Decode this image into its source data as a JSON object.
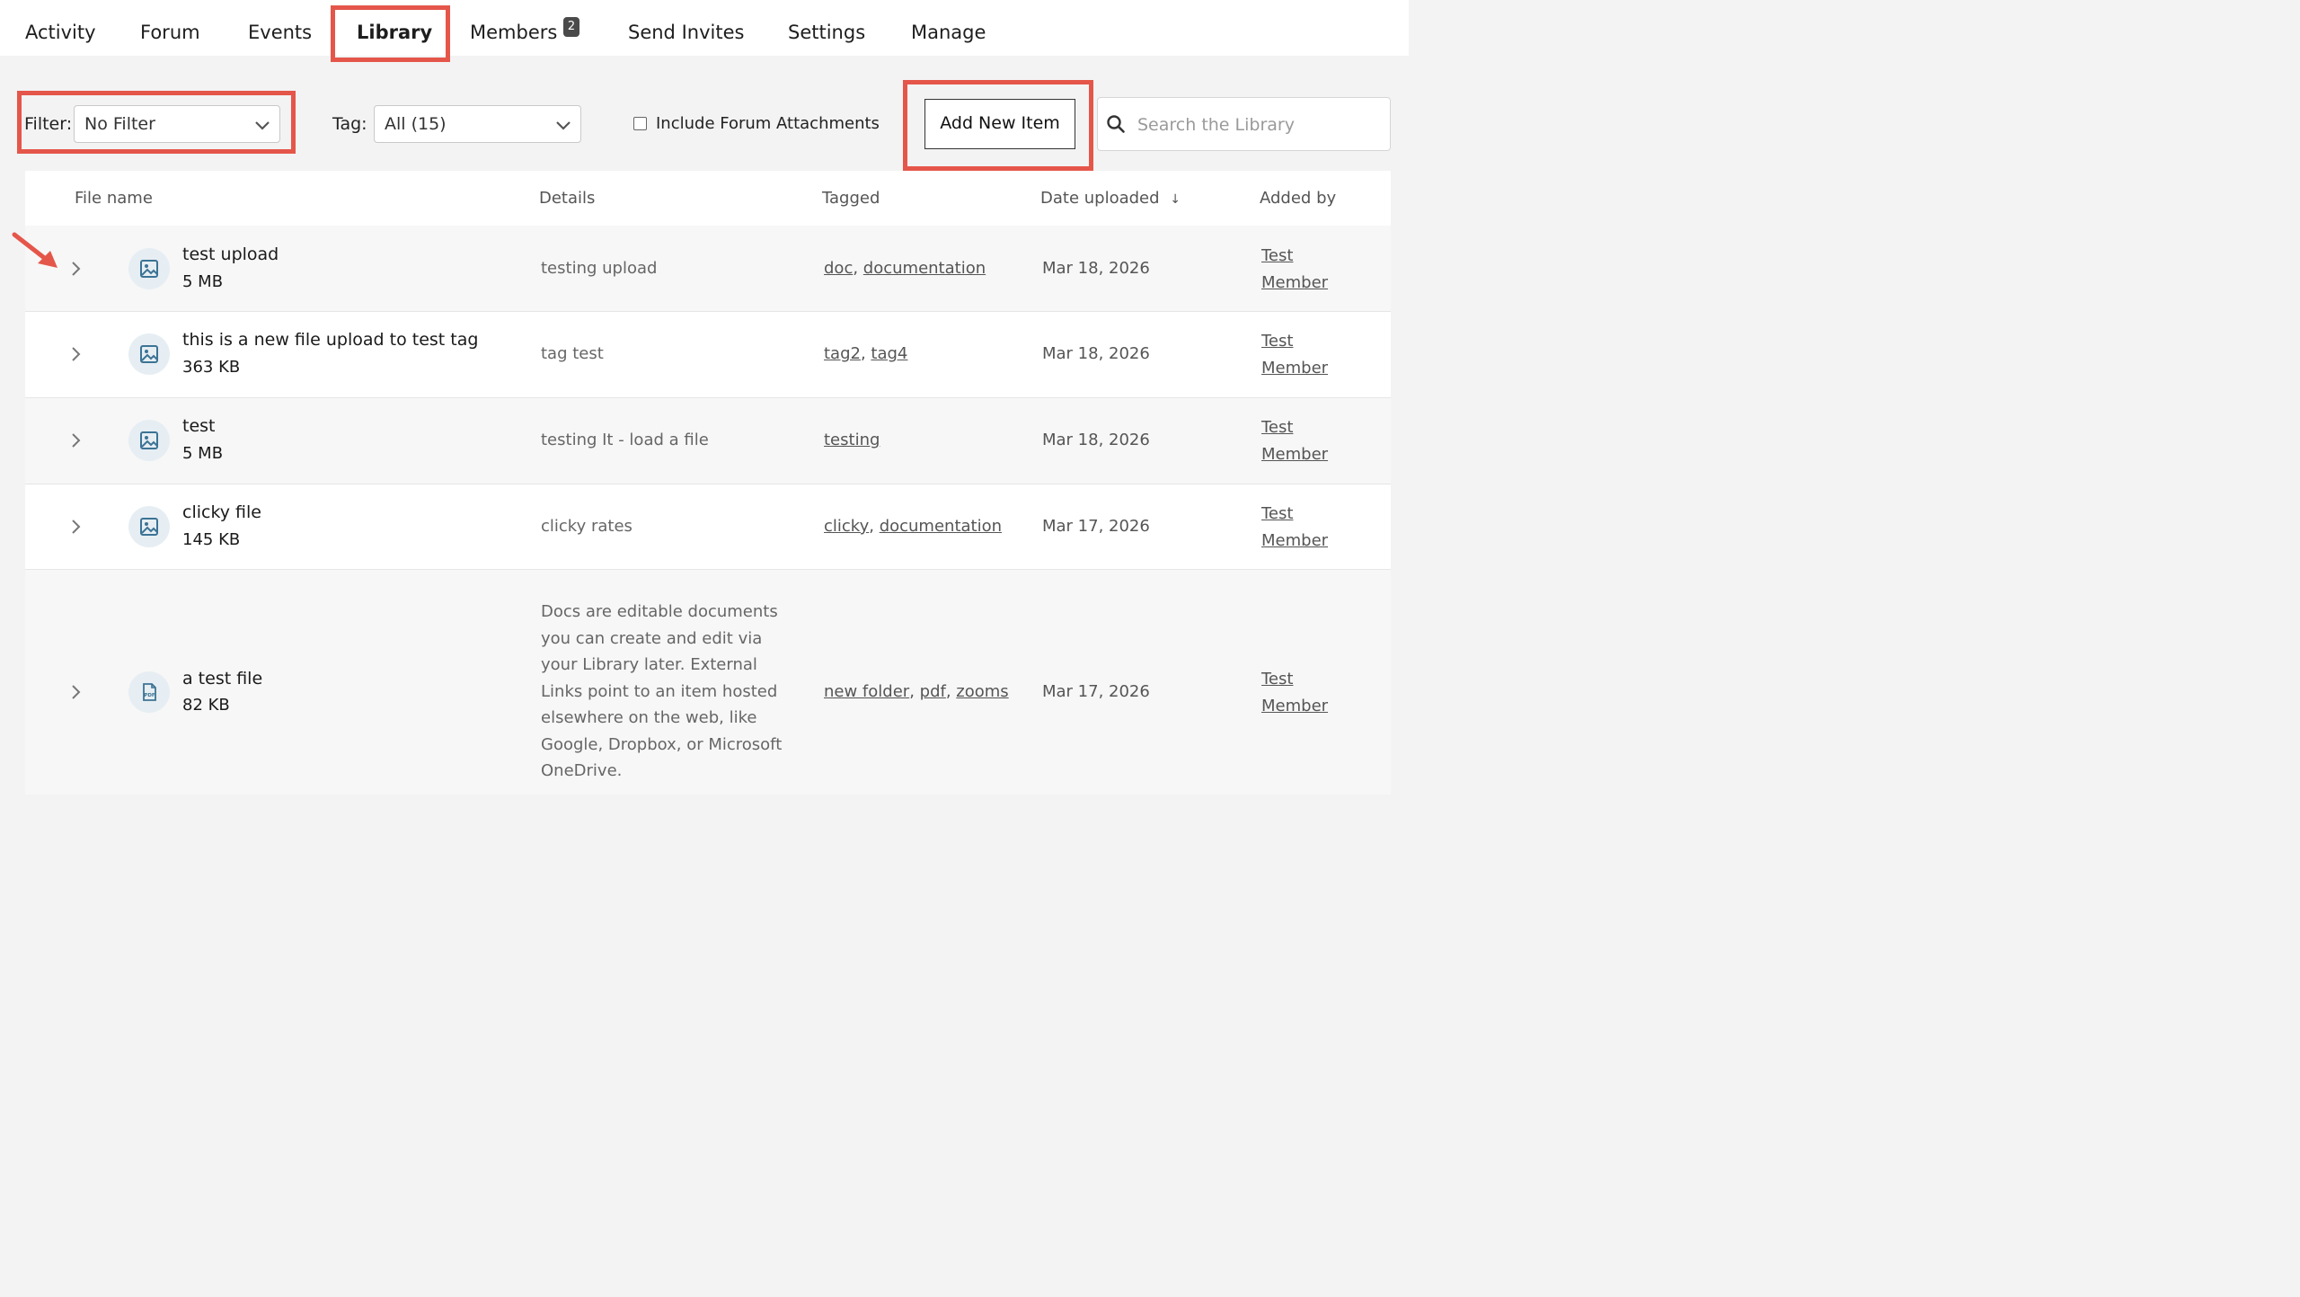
{
  "nav": {
    "tabs": [
      {
        "label": "Activity"
      },
      {
        "label": "Forum"
      },
      {
        "label": "Events"
      },
      {
        "label": "Library"
      },
      {
        "label": "Members"
      },
      {
        "label": "Send Invites"
      },
      {
        "label": "Settings"
      },
      {
        "label": "Manage"
      }
    ],
    "active_tab": "Library",
    "members_badge": "2"
  },
  "toolbar": {
    "filter_label": "Filter:",
    "filter_value": "No Filter",
    "tag_label": "Tag:",
    "tag_value": "All (15)",
    "include_label": "Include Forum Attachments",
    "include_checked": false,
    "add_button": "Add New Item",
    "search_placeholder": "Search the Library"
  },
  "table": {
    "headers": {
      "file_name": "File name",
      "details": "Details",
      "tagged": "Tagged",
      "date_uploaded": "Date uploaded",
      "sort_indicator": "↓",
      "added_by": "Added by"
    },
    "rows": [
      {
        "name": "test upload",
        "size": "5 MB",
        "icon": "image-file-icon",
        "details": "testing upload",
        "tags": [
          "doc",
          "documentation"
        ],
        "date": "Mar 18, 2026",
        "added_by": "Test Member"
      },
      {
        "name": "this is a new file upload to test tag",
        "size": "363 KB",
        "icon": "image-file-icon",
        "details": "tag test",
        "tags": [
          "tag2",
          "tag4"
        ],
        "date": "Mar 18, 2026",
        "added_by": "Test Member"
      },
      {
        "name": "test",
        "size": "5 MB",
        "icon": "image-file-icon",
        "details": "testing It - load a file",
        "tags": [
          "testing"
        ],
        "date": "Mar 18, 2026",
        "added_by": "Test Member"
      },
      {
        "name": "clicky file",
        "size": "145 KB",
        "icon": "image-file-icon",
        "details": "clicky rates",
        "tags": [
          "clicky",
          "documentation"
        ],
        "date": "Mar 17, 2026",
        "added_by": "Test Member"
      },
      {
        "name": "a test file",
        "size": "82 KB",
        "icon": "pdf-file-icon",
        "details": "Docs are editable documents you can create and edit via your Library later. External Links point to an item hosted elsewhere on the web, like Google, Dropbox, or Microsoft OneDrive.",
        "tags": [
          "new folder",
          "pdf",
          "zooms"
        ],
        "date": "Mar 17, 2026",
        "added_by": "Test Member"
      }
    ]
  },
  "colors": {
    "highlight": "#e5564a",
    "icon_bg": "#e6eef3",
    "icon_stroke": "#3c7395"
  }
}
